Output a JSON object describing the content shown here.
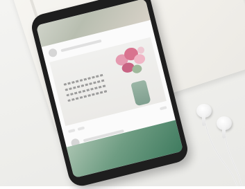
{
  "scene": {
    "icons": {
      "notebook": "notebook-icon",
      "phone": "smartphone-icon",
      "earbuds": "earbuds-icon"
    },
    "colors": {
      "table": "#eeeeeb",
      "notebook": "#f1efea",
      "phone_body": "#1e1e1e",
      "screen": "#fbfbfb",
      "flowers": "#d97a95",
      "vase": "#8faa9a",
      "bottom_photo": "#5f8f75",
      "earbuds": "#f5f5f5"
    }
  }
}
